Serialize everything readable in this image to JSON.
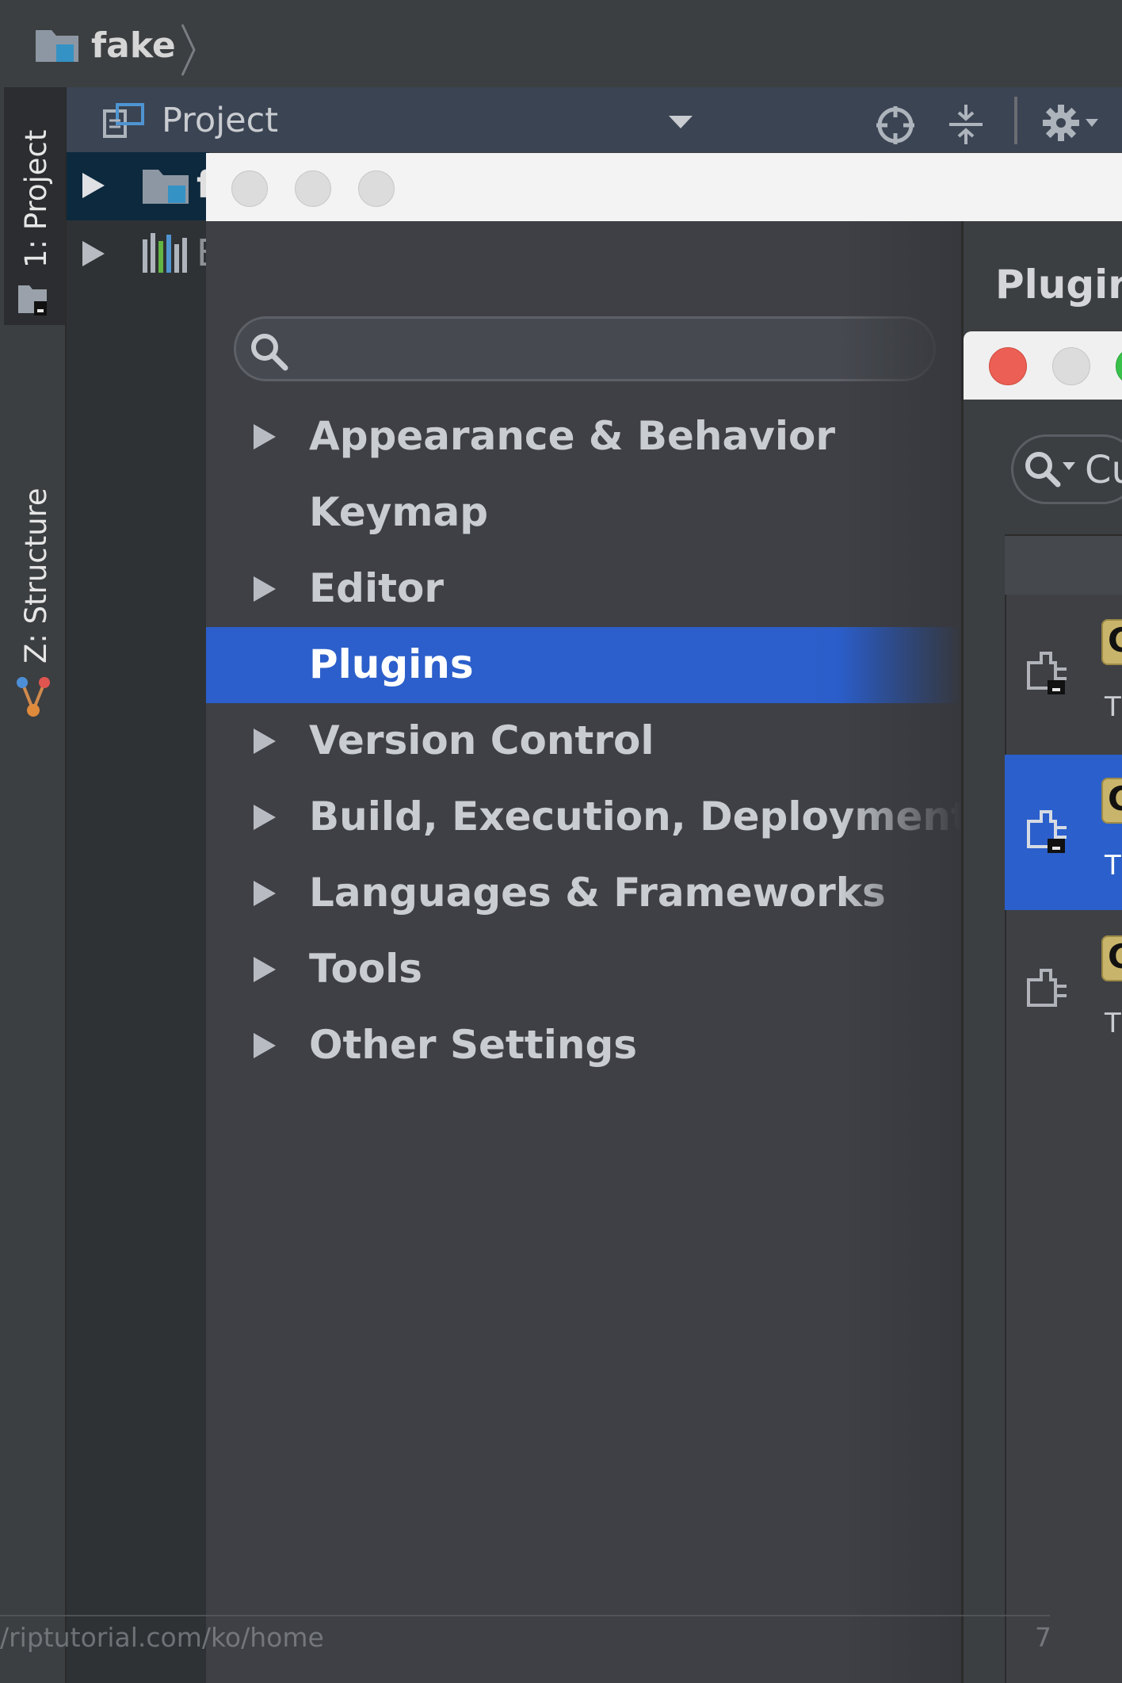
{
  "breadcrumb": {
    "project_name": "fake"
  },
  "tool_windows": {
    "project_tab": "1: Project",
    "structure_tab": "Z: Structure"
  },
  "project_panel": {
    "title": "Project",
    "tree": [
      {
        "label": "f",
        "icon": "folder-icon",
        "selected": true
      },
      {
        "label": "E",
        "icon": "libraries-icon",
        "selected": false
      }
    ]
  },
  "settings": {
    "search_placeholder": "",
    "nav": [
      {
        "label": "Appearance & Behavior",
        "expandable": true,
        "selected": false
      },
      {
        "label": "Keymap",
        "expandable": false,
        "selected": false
      },
      {
        "label": "Editor",
        "expandable": true,
        "selected": false
      },
      {
        "label": "Plugins",
        "expandable": false,
        "selected": true
      },
      {
        "label": "Version Control",
        "expandable": true,
        "selected": false
      },
      {
        "label": "Build, Execution, Deployment",
        "expandable": true,
        "selected": false
      },
      {
        "label": "Languages & Frameworks",
        "expandable": true,
        "selected": false
      },
      {
        "label": "Tools",
        "expandable": true,
        "selected": false
      },
      {
        "label": "Other Settings",
        "expandable": true,
        "selected": false
      }
    ],
    "right_title": "Plugin",
    "plugin_search_text": "Cu",
    "plugin_rows": [
      {
        "badge": "C",
        "sub": "T",
        "selected": false
      },
      {
        "badge": "C",
        "sub": "T",
        "selected": true
      },
      {
        "badge": "C",
        "sub": "T",
        "selected": false
      }
    ]
  },
  "footer": {
    "url": "/riptutorial.com/ko/home",
    "page": "7"
  },
  "colors": {
    "selection": "#2c5fcb",
    "panel_bg": "#3c3f41",
    "close_red": "#ec5f54",
    "zoom_green": "#39c04b"
  }
}
